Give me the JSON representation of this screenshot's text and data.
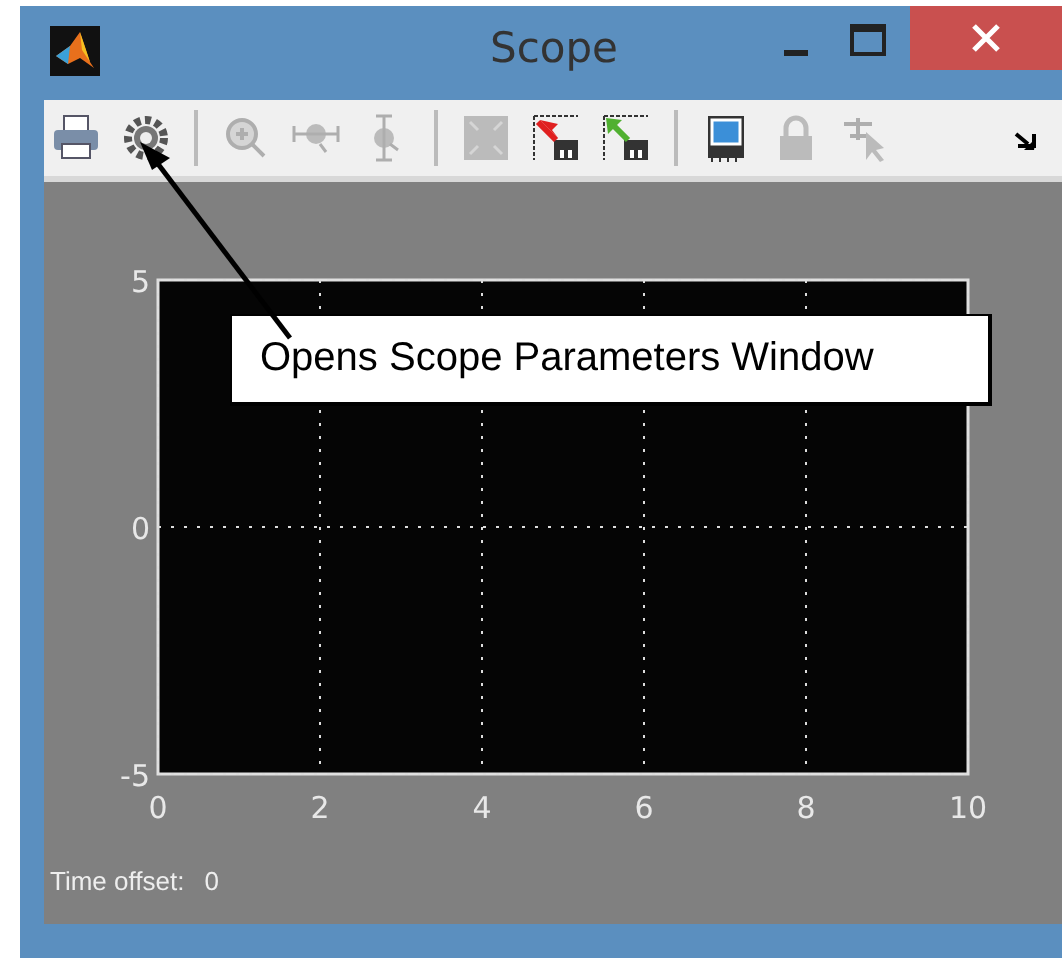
{
  "window": {
    "title": "Scope"
  },
  "toolbar": {
    "groups": [
      {
        "buttons": [
          {
            "kind": "print",
            "disabled": false
          },
          {
            "kind": "parameters",
            "disabled": false
          }
        ]
      },
      {
        "buttons": [
          {
            "kind": "zoom",
            "disabled": true
          },
          {
            "kind": "zoom-x",
            "disabled": true
          },
          {
            "kind": "zoom-y",
            "disabled": true
          }
        ]
      },
      {
        "buttons": [
          {
            "kind": "autoscale",
            "disabled": true
          },
          {
            "kind": "save-axes",
            "disabled": false
          },
          {
            "kind": "restore-axes",
            "disabled": false
          }
        ]
      },
      {
        "buttons": [
          {
            "kind": "floating",
            "disabled": false
          },
          {
            "kind": "lock",
            "disabled": true
          },
          {
            "kind": "signal-select",
            "disabled": true
          }
        ]
      }
    ]
  },
  "plot": {
    "chart_data": {
      "type": "line",
      "xlim": [
        0,
        10
      ],
      "ylim": [
        -5,
        5
      ],
      "xticks": [
        0,
        2,
        4,
        6,
        8,
        10
      ],
      "yticks": [
        -5,
        0,
        5
      ],
      "grid": true
    }
  },
  "callout": {
    "text": "Opens Scope Parameters Window"
  },
  "status": {
    "label": "Time offset:",
    "value": "0"
  }
}
